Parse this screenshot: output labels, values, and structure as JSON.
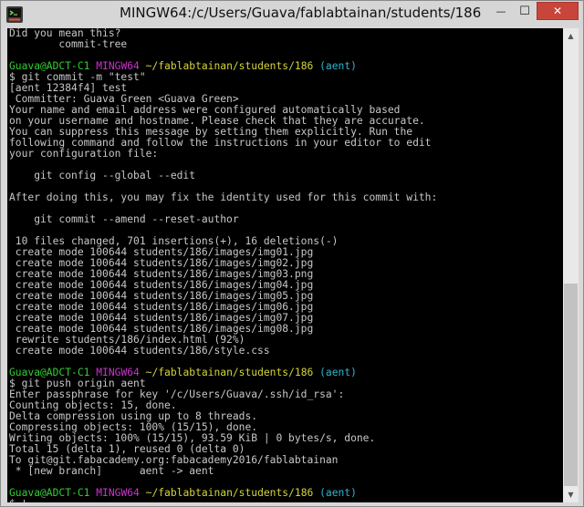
{
  "window": {
    "title": "MINGW64:/c/Users/Guava/fablabtainan/students/186",
    "minimize_symbol": "—",
    "maximize_symbol": "☐",
    "close_symbol": "✕",
    "icon": "git-bash-icon"
  },
  "colors": {
    "prompt_user": "#33cc33",
    "prompt_env": "#cc33cc",
    "prompt_path": "#d4d43a",
    "prompt_branch": "#2fb4d0",
    "text": "#c7c7c7",
    "close_button": "#c7453a"
  },
  "terminal": {
    "l0": "Did you mean this?",
    "l1": "        commit-tree",
    "p1": {
      "user": "Guava@ADCT-C1",
      "env": "MINGW64",
      "path": "~/fablabtainan/students/186",
      "branch": "(aent)"
    },
    "l4": "$ git commit -m \"test\"",
    "l5": "[aent 12384f4] test",
    "l6": " Committer: Guava Green <Guava Green>",
    "l7": "Your name and email address were configured automatically based",
    "l8": "on your username and hostname. Please check that they are accurate.",
    "l9": "You can suppress this message by setting them explicitly. Run the",
    "l10": "following command and follow the instructions in your editor to edit",
    "l11": "your configuration file:",
    "l13": "    git config --global --edit",
    "l15": "After doing this, you may fix the identity used for this commit with:",
    "l17": "    git commit --amend --reset-author",
    "l19": " 10 files changed, 701 insertions(+), 16 deletions(-)",
    "l20": " create mode 100644 students/186/images/img01.jpg",
    "l21": " create mode 100644 students/186/images/img02.jpg",
    "l22": " create mode 100644 students/186/images/img03.png",
    "l23": " create mode 100644 students/186/images/img04.jpg",
    "l24": " create mode 100644 students/186/images/img05.jpg",
    "l25": " create mode 100644 students/186/images/img06.jpg",
    "l26": " create mode 100644 students/186/images/img07.jpg",
    "l27": " create mode 100644 students/186/images/img08.jpg",
    "l28": " rewrite students/186/index.html (92%)",
    "l29": " create mode 100644 students/186/style.css",
    "p2": {
      "user": "Guava@ADCT-C1",
      "env": "MINGW64",
      "path": "~/fablabtainan/students/186",
      "branch": "(aent)"
    },
    "l32": "$ git push origin aent",
    "l33": "Enter passphrase for key '/c/Users/Guava/.ssh/id_rsa':",
    "l34": "Counting objects: 15, done.",
    "l35": "Delta compression using up to 8 threads.",
    "l36": "Compressing objects: 100% (15/15), done.",
    "l37": "Writing objects: 100% (15/15), 93.59 KiB | 0 bytes/s, done.",
    "l38": "Total 15 (delta 1), reused 0 (delta 0)",
    "l39": "To git@git.fabacademy.org:fabacademy2016/fablabtainan",
    "l40": " * [new branch]      aent -> aent",
    "p3": {
      "user": "Guava@ADCT-C1",
      "env": "MINGW64",
      "path": "~/fablabtainan/students/186",
      "branch": "(aent)"
    },
    "l43": "$ "
  }
}
